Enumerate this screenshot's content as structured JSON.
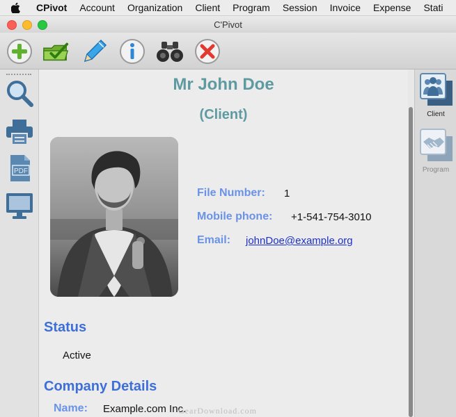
{
  "menubar": {
    "app_name": "CPivot",
    "items": [
      "Account",
      "Organization",
      "Client",
      "Program",
      "Session",
      "Invoice",
      "Expense",
      "Stati"
    ]
  },
  "window": {
    "title": "C'Pivot"
  },
  "toolbar": {
    "buttons": [
      {
        "name": "add",
        "icon": "plus-circle-icon"
      },
      {
        "name": "open",
        "icon": "folder-check-icon"
      },
      {
        "name": "edit",
        "icon": "pencil-icon"
      },
      {
        "name": "info",
        "icon": "info-icon"
      },
      {
        "name": "find",
        "icon": "binoculars-icon"
      },
      {
        "name": "delete",
        "icon": "x-circle-icon"
      }
    ]
  },
  "left_sidebar": {
    "items": [
      {
        "name": "search",
        "icon": "magnifier-icon"
      },
      {
        "name": "print",
        "icon": "printer-icon"
      },
      {
        "name": "pdf",
        "icon": "pdf-icon",
        "icon_text": "PDF"
      },
      {
        "name": "screen",
        "icon": "monitor-icon"
      }
    ]
  },
  "right_sidebar": {
    "items": [
      {
        "label": "Client",
        "icon": "people-icon",
        "selected": true
      },
      {
        "label": "Program",
        "icon": "handshake-icon",
        "selected": false
      }
    ]
  },
  "client": {
    "name": "Mr John Doe",
    "role": "(Client)",
    "file_number_label": "File Number:",
    "file_number": "1",
    "mobile_label": "Mobile phone:",
    "mobile": "+1-541-754-3010",
    "email_label": "Email:",
    "email": "johnDoe@example.org"
  },
  "status_section": {
    "heading": "Status",
    "value": "Active"
  },
  "company_section": {
    "heading": "Company Details",
    "name_label": "Name:",
    "name_value": "Example.com Inc."
  },
  "watermark": "GearDownload.com",
  "colors": {
    "title_teal": "#5e9aa0",
    "label_blue": "#6a92e6",
    "heading_blue": "#3d6fd8",
    "link_blue": "#1d30c8"
  }
}
